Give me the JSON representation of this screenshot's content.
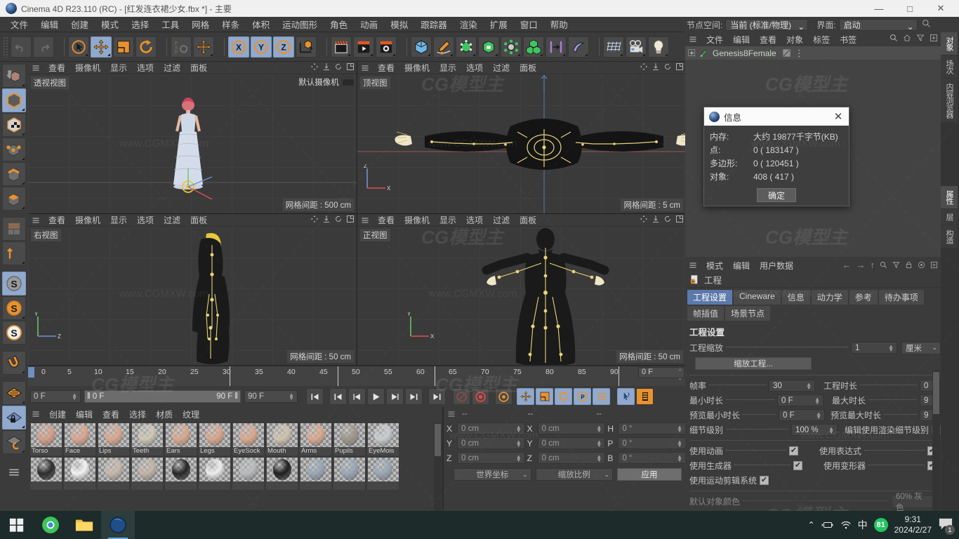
{
  "window": {
    "title": "Cinema 4D R23.110 (RC) - [红发连衣裙少女.fbx *] - 主要",
    "minimize": "—",
    "maximize": "□",
    "close": "✕"
  },
  "menubar": [
    "文件",
    "编辑",
    "创建",
    "模式",
    "选择",
    "工具",
    "网格",
    "样条",
    "体积",
    "运动图形",
    "角色",
    "动画",
    "模拟",
    "跟踪器",
    "渲染",
    "扩展",
    "窗口",
    "帮助"
  ],
  "nodespace": {
    "label": "节点空间:",
    "value": "当前 (标准/物理)",
    "interface_label": "界面:",
    "interface_value": "启动"
  },
  "toolbar": {
    "undo": "undo-icon",
    "redo": "redo-icon",
    "select": "live-selection-icon",
    "move": "move-icon",
    "scale": "scale-icon",
    "rotate": "rotate-icon",
    "psr": "psr-icon",
    "move_alt": "move-world-icon",
    "axis_x": "X",
    "axis_y": "Y",
    "axis_z": "Z",
    "world": "world-coordinates-icon",
    "render_view": "render-view-icon",
    "render_picture": "render-to-picture-icon",
    "render_settings": "render-settings-icon",
    "cube": "primitive-cube-icon",
    "spline": "spline-pen-icon",
    "generator": "generator-icon",
    "boolean": "deformer-bend-icon",
    "mograph": "mograph-icon",
    "array": "array-icon",
    "connect": "connect-icon",
    "deform": "deform-icon",
    "scene": "scene-grid-icon",
    "camera": "camera-icon",
    "light": "light-icon"
  },
  "left_toolbar": [
    {
      "name": "make-editable-icon",
      "selected": false
    },
    {
      "name": "model-mode-icon",
      "selected": true
    },
    {
      "name": "texture-mode-icon",
      "selected": false
    },
    {
      "name": "point-mode-icon",
      "selected": false
    },
    {
      "name": "edge-mode-icon",
      "selected": false
    },
    {
      "name": "polygon-mode-icon",
      "selected": false
    },
    {
      "name": "uv-mode-icon",
      "selected": false
    },
    {
      "name": "axis-mode-icon",
      "selected": false
    },
    {
      "name": "s-grey-icon",
      "selected": true
    },
    {
      "name": "s-orange-icon",
      "selected": false
    },
    {
      "name": "s-white-icon",
      "selected": false
    },
    {
      "name": "magnet-icon",
      "selected": false
    },
    {
      "name": "workplane-icon",
      "selected": false
    },
    {
      "name": "workplane-lock-icon",
      "selected": true
    },
    {
      "name": "workplane-rotate-icon",
      "selected": false
    }
  ],
  "viewports": {
    "menu": [
      "查看",
      "摄像机",
      "显示",
      "选项",
      "过滤",
      "面板"
    ],
    "panes": [
      {
        "label": "透视视图",
        "grid": "网格间距 : 500 cm",
        "camera": "默认摄像机"
      },
      {
        "label": "顶视图",
        "grid": "网格间距 : 5 cm",
        "camera": ""
      },
      {
        "label": "右视图",
        "grid": "网格间距 : 50 cm",
        "camera": ""
      },
      {
        "label": "正视图",
        "grid": "网格间距 : 50 cm",
        "camera": ""
      }
    ]
  },
  "timeline": {
    "ticks": [
      0,
      5,
      10,
      15,
      20,
      25,
      30,
      35,
      40,
      45,
      50,
      55,
      60,
      65,
      70,
      75,
      80,
      85,
      90
    ],
    "current_frame": "0 F",
    "range_start": "0 F",
    "range_end": "90 F",
    "preview_start": "0 F",
    "preview_end": "90 F",
    "end_field": "90 F",
    "right_field": "0 F"
  },
  "transport": {
    "first": "go-to-start-icon",
    "prevkey": "prev-key-icon",
    "prevframe": "prev-frame-icon",
    "play": "play-icon",
    "nextframe": "next-frame-icon",
    "nextkey": "next-key-icon",
    "last": "go-to-end-icon",
    "record_active": "record-active-objects-icon",
    "autokey": "autokey-icon",
    "keyframe_settings": "keyframe-selection-icon",
    "pos": "record-position-icon",
    "scl": "record-scale-icon",
    "rot": "record-rotation-icon",
    "param": "record-parameter-icon",
    "pla": "point-level-animation-icon",
    "anim_mode": "animation-mode-icon",
    "timeline_toggle": "timeline-toggle-icon"
  },
  "material_manager": {
    "menu": [
      "创建",
      "编辑",
      "查看",
      "选择",
      "材质",
      "纹理"
    ],
    "materials_row1": [
      {
        "name": "Torso",
        "color": "#d3a08a"
      },
      {
        "name": "Face",
        "color": "#d9a78f"
      },
      {
        "name": "Lips",
        "color": "#d8a88f"
      },
      {
        "name": "Teeth",
        "color": "#cfc7b6"
      },
      {
        "name": "Ears",
        "color": "#d9a88f"
      },
      {
        "name": "Legs",
        "color": "#d7a68d"
      },
      {
        "name": "EyeSock",
        "color": "#d9a88f"
      },
      {
        "name": "Mouth",
        "color": "#cfc3ae"
      },
      {
        "name": "Arms",
        "color": "#d9a88f"
      },
      {
        "name": "Pupils",
        "color": "#9f968c"
      },
      {
        "name": "EyeMois",
        "color": "#c9ccce"
      }
    ],
    "materials_row2": [
      {
        "name": "",
        "color": "#2d2d2d"
      },
      {
        "name": "",
        "color": "#f2f2f2"
      },
      {
        "name": "",
        "color": "#c6b9ad"
      },
      {
        "name": "",
        "color": "#c2b4a7"
      },
      {
        "name": "",
        "color": "#272727"
      },
      {
        "name": "",
        "color": "#ededed"
      },
      {
        "name": "",
        "color": "#b9bcbe"
      },
      {
        "name": "",
        "color": "#1f1f1f"
      },
      {
        "name": "",
        "color": "#9aa7b6"
      },
      {
        "name": "",
        "color": "#9aa7b6"
      },
      {
        "name": "",
        "color": "#9aa7b6"
      }
    ]
  },
  "coordinates": {
    "header": [
      "--",
      "--",
      "--"
    ],
    "rows": [
      {
        "axis": "X",
        "pos": "0 cm",
        "size": "0 cm",
        "rot_label": "H",
        "rot": "0 °"
      },
      {
        "axis": "Y",
        "pos": "0 cm",
        "size": "0 cm",
        "rot_label": "P",
        "rot": "0 °"
      },
      {
        "axis": "Z",
        "pos": "0 cm",
        "size": "0 cm",
        "rot_label": "B",
        "rot": "0 °"
      }
    ],
    "coord_system": "世界坐标",
    "scale_mode": "缩放比例",
    "apply": "应用"
  },
  "object_manager": {
    "menu": [
      "文件",
      "编辑",
      "查看",
      "对象",
      "标签",
      "书签"
    ],
    "rows": [
      {
        "name": "Genesis8Female"
      }
    ]
  },
  "attribute_manager": {
    "menu": [
      "模式",
      "编辑",
      "用户数据"
    ],
    "object_name": "工程",
    "tabs": [
      {
        "label": "工程设置",
        "selected": true
      },
      {
        "label": "Cineware",
        "selected": false
      },
      {
        "label": "信息",
        "selected": false
      },
      {
        "label": "动力学",
        "selected": false
      },
      {
        "label": "参考",
        "selected": false
      },
      {
        "label": "待办事项",
        "selected": false
      },
      {
        "label": "帧插值",
        "selected": false
      },
      {
        "label": "场景节点",
        "selected": false
      }
    ],
    "section_title": "工程设置",
    "project_scale_label": "工程缩放",
    "project_scale_value": "1",
    "project_scale_unit": "厘米",
    "scale_project_button": "缩放工程...",
    "rows": [
      {
        "label": "帧率",
        "value": "30",
        "label2": "工程时长",
        "value2": "0"
      },
      {
        "label": "最小时长",
        "value": "0 F",
        "label2": "最大时长",
        "value2": "9"
      },
      {
        "label": "预览最小时长",
        "value": "0 F",
        "label2": "预览最大时长",
        "value2": "9"
      }
    ],
    "lod_label": "细节级别",
    "lod_value": "100 %",
    "lod_render_label": "编辑使用渲染细节级别",
    "lod_render_checked": false,
    "checks": [
      {
        "label": "使用动画",
        "checked": true,
        "label2": "使用表达式",
        "checked2": true
      },
      {
        "label": "使用生成器",
        "checked": true,
        "label2": "使用变形器",
        "checked2": true
      },
      {
        "label": "使用运动剪辑系统",
        "checked": true,
        "label2": "",
        "checked2": null
      }
    ],
    "last_row_label": "默认对象颜色",
    "last_row_value": "60% 灰色"
  },
  "vertical_tabs_top": [
    {
      "label": "对象",
      "selected": true
    },
    {
      "label": "场次",
      "selected": false
    },
    {
      "label": "内容浏览器",
      "selected": false
    }
  ],
  "vertical_tabs_bottom": [
    {
      "label": "属性",
      "selected": true
    },
    {
      "label": "层",
      "selected": false
    },
    {
      "label": "构造",
      "selected": false
    }
  ],
  "info_dialog": {
    "title": "信息",
    "close": "✕",
    "rows": [
      {
        "key": "内存:",
        "value": "大约 19877千字节(KB)"
      },
      {
        "key": "点:",
        "value": "0 ( 183147 )"
      },
      {
        "key": "多边形:",
        "value": "0 ( 120451 )"
      },
      {
        "key": "对象:",
        "value": "408 ( 417 )"
      }
    ],
    "ok": "确定"
  },
  "taskbar": {
    "start": "windows-start-icon",
    "apps": [
      "chrome-icon",
      "file-explorer-icon",
      "cinema4d-icon"
    ],
    "chevron": "⌃",
    "battery": "battery-icon",
    "wifi": "wifi-icon",
    "ime": "中",
    "badge": "81",
    "time": "9:31",
    "date": "2024/2/27",
    "notification": "1"
  },
  "watermarks": [
    "www.CGMXW.com",
    "CG模型主"
  ],
  "colors": {
    "accent_orange": "#e8922e",
    "selection_blue": "#90a9cd",
    "panel_bg": "#3b3b3b",
    "viewport_bg": "#3a3a3a",
    "tab_active": "#5b79aa"
  }
}
